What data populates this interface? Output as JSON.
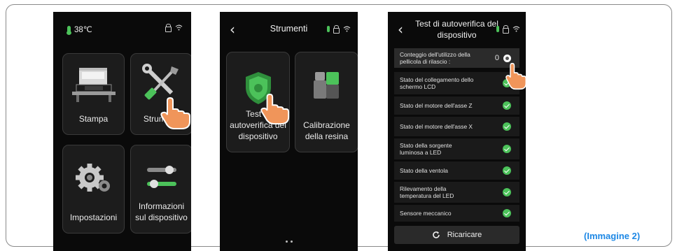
{
  "screen1": {
    "temperature": "38℃",
    "tiles": [
      {
        "label": "Stampa"
      },
      {
        "label": "Strumenti"
      },
      {
        "label": "Impostazioni"
      },
      {
        "label": "Informazioni sul dispositivo"
      }
    ]
  },
  "screen2": {
    "title": "Strumenti",
    "tiles": [
      {
        "label": "Test di autoverifica del dispositivo"
      },
      {
        "label": "Calibrazione della resina"
      }
    ]
  },
  "screen3": {
    "title": "Test di autoverifica del dispositivo",
    "count_label": "Conteggio dell'utilizzo della pellicola di rilascio :",
    "count_value": "0",
    "checks": [
      {
        "label": "Stato del collegamento dello schermo LCD",
        "status": "ok"
      },
      {
        "label": "Stato del motore dell'asse Z",
        "status": "ok"
      },
      {
        "label": "Stato del motore dell'asse X",
        "status": "ok"
      },
      {
        "label": "Stato della sorgente luminosa a LED",
        "status": "ok"
      },
      {
        "label": "Stato della ventola",
        "status": "ok"
      },
      {
        "label": "Rilevamento della temperatura del LED",
        "status": "ok"
      },
      {
        "label": "Sensore meccanico",
        "status": "ok"
      }
    ],
    "reload_label": "Ricaricare"
  },
  "caption": "(Immagine 2)",
  "colors": {
    "accent": "#4cc25a",
    "caption": "#1e88e5",
    "hand": "#f0955a"
  }
}
